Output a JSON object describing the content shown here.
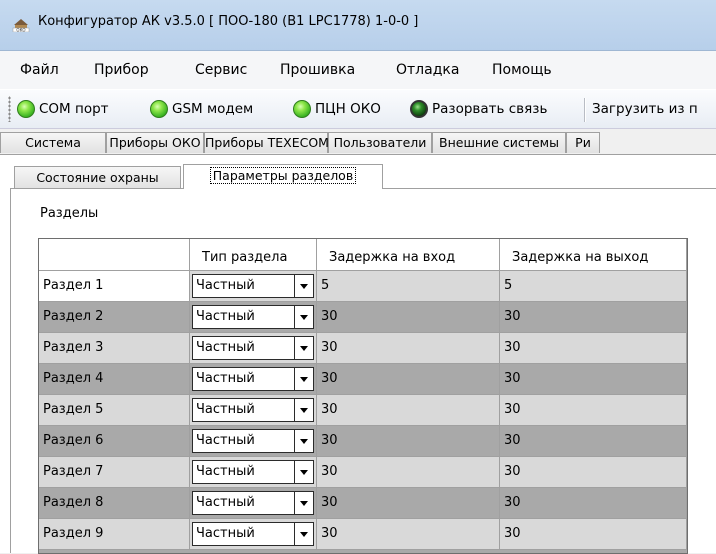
{
  "window": {
    "title": "Конфигуратор АК v3.5.0 [ ПОО-180 (B1 LPC1778) 1-0-0 ]"
  },
  "menu": [
    "Файл",
    "Прибор",
    "Сервис",
    "Прошивка",
    "Отладка",
    "Помощь"
  ],
  "toolbar": {
    "com_port": "COM порт",
    "gsm_modem": "GSM модем",
    "pcn_oko": "ПЦН ОКО",
    "disconnect": "Разорвать связь",
    "load_from": "Загрузить из п"
  },
  "main_tabs": [
    "Система",
    "Приборы ОКО",
    "Приборы TEXECOM",
    "Пользователи",
    "Внешние системы",
    "Ри"
  ],
  "sub_tabs": [
    "Состояние охраны",
    "Параметры разделов"
  ],
  "group_label": "Разделы",
  "table": {
    "columns": [
      "",
      "Тип раздела",
      "Задержка на вход",
      "Задержка на выход"
    ],
    "rows": [
      {
        "name": "Раздел 1",
        "type": "Частный",
        "entry": "5",
        "exit": "5"
      },
      {
        "name": "Раздел 2",
        "type": "Частный",
        "entry": "30",
        "exit": "30"
      },
      {
        "name": "Раздел 3",
        "type": "Частный",
        "entry": "30",
        "exit": "30"
      },
      {
        "name": "Раздел 4",
        "type": "Частный",
        "entry": "30",
        "exit": "30"
      },
      {
        "name": "Раздел 5",
        "type": "Частный",
        "entry": "30",
        "exit": "30"
      },
      {
        "name": "Раздел 6",
        "type": "Частный",
        "entry": "30",
        "exit": "30"
      },
      {
        "name": "Раздел 7",
        "type": "Частный",
        "entry": "30",
        "exit": "30"
      },
      {
        "name": "Раздел 8",
        "type": "Частный",
        "entry": "30",
        "exit": "30"
      },
      {
        "name": "Раздел 9",
        "type": "Частный",
        "entry": "30",
        "exit": "30"
      }
    ]
  },
  "colors": {
    "row_light": "#d9d9d9",
    "row_dark": "#a9a9a9",
    "led_green": "#3db524"
  }
}
